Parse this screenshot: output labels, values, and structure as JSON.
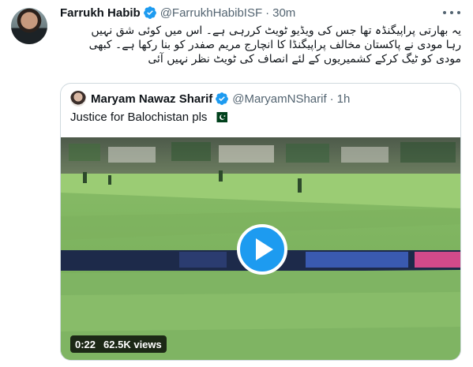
{
  "tweet": {
    "author": {
      "display_name": "Farrukh Habib",
      "handle": "@FarrukhHabibISF",
      "time": "30m"
    },
    "text_lines": [
      "یہ بھارتی پراپیگنڈہ تھا جس کی ویڈیو ٹویٹ کررہی ہے۔ اس میں کوئی شق نہیں",
      "رہا مودی نے پاکستان مخالف پراپیگنڈا کا انچارج مریم صفدر کو بنا رکھا ہے۔ کبھی",
      "مودی کو ٹیگ کرکے کشمیریوں کے لئے انصاف کی ٹویٹ نظر نہیں آئی"
    ],
    "more_icon": "more-horizontal-icon",
    "verified_color": "#1d9bf0"
  },
  "quoted": {
    "author": {
      "display_name": "Maryam Nawaz Sharif",
      "handle": "@MaryamNSharif",
      "time": "1h"
    },
    "text": "Justice for Balochistan pls",
    "emoji": "pakistan-flag-icon",
    "video": {
      "duration": "0:22",
      "views": "62.5K views"
    }
  },
  "colors": {
    "accent": "#1d9bf0",
    "secondary_text": "#536471",
    "border": "#cfd9de"
  }
}
